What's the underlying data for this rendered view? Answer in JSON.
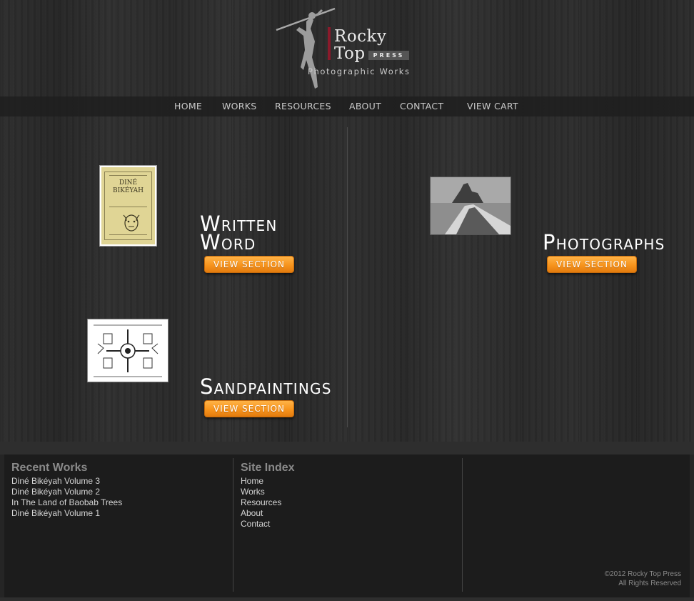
{
  "logo": {
    "line1": "Rocky",
    "line2": "Top",
    "press": "PRESS",
    "subtitle": "Photographic Works"
  },
  "nav": {
    "items": [
      "HOME",
      "WORKS",
      "RESOURCES",
      "ABOUT",
      "CONTACT",
      "VIEW CART"
    ]
  },
  "sections": {
    "written_word": {
      "title_line1": "Written",
      "title_line2": "Word",
      "button": "VIEW SECTION",
      "thumb_title": "DINÉ BIKÉYAH"
    },
    "photographs": {
      "title": "Photographs",
      "button": "VIEW SECTION"
    },
    "sandpaintings": {
      "title": "Sandpaintings",
      "button": "VIEW SECTION"
    }
  },
  "footer": {
    "recent_works": {
      "heading": "Recent Works",
      "items": [
        "Diné Bikéyah Volume 3",
        "Diné Bikéyah Volume 2",
        "In The Land of Baobab Trees",
        "Diné Bikéyah Volume 1"
      ]
    },
    "site_index": {
      "heading": "Site Index",
      "items": [
        "Home",
        "Works",
        "Resources",
        "About",
        "Contact"
      ]
    },
    "copyright_line1": "©2012 Rocky Top Press",
    "copyright_line2": "All Rights Reserved"
  },
  "colors": {
    "accent_orange": "#f7941d",
    "logo_red": "#8b1a2b",
    "background": "#2a2a2a",
    "footer_bg": "#1c1c1c"
  },
  "icons": {
    "logo_figure": "climber-figure-icon"
  }
}
